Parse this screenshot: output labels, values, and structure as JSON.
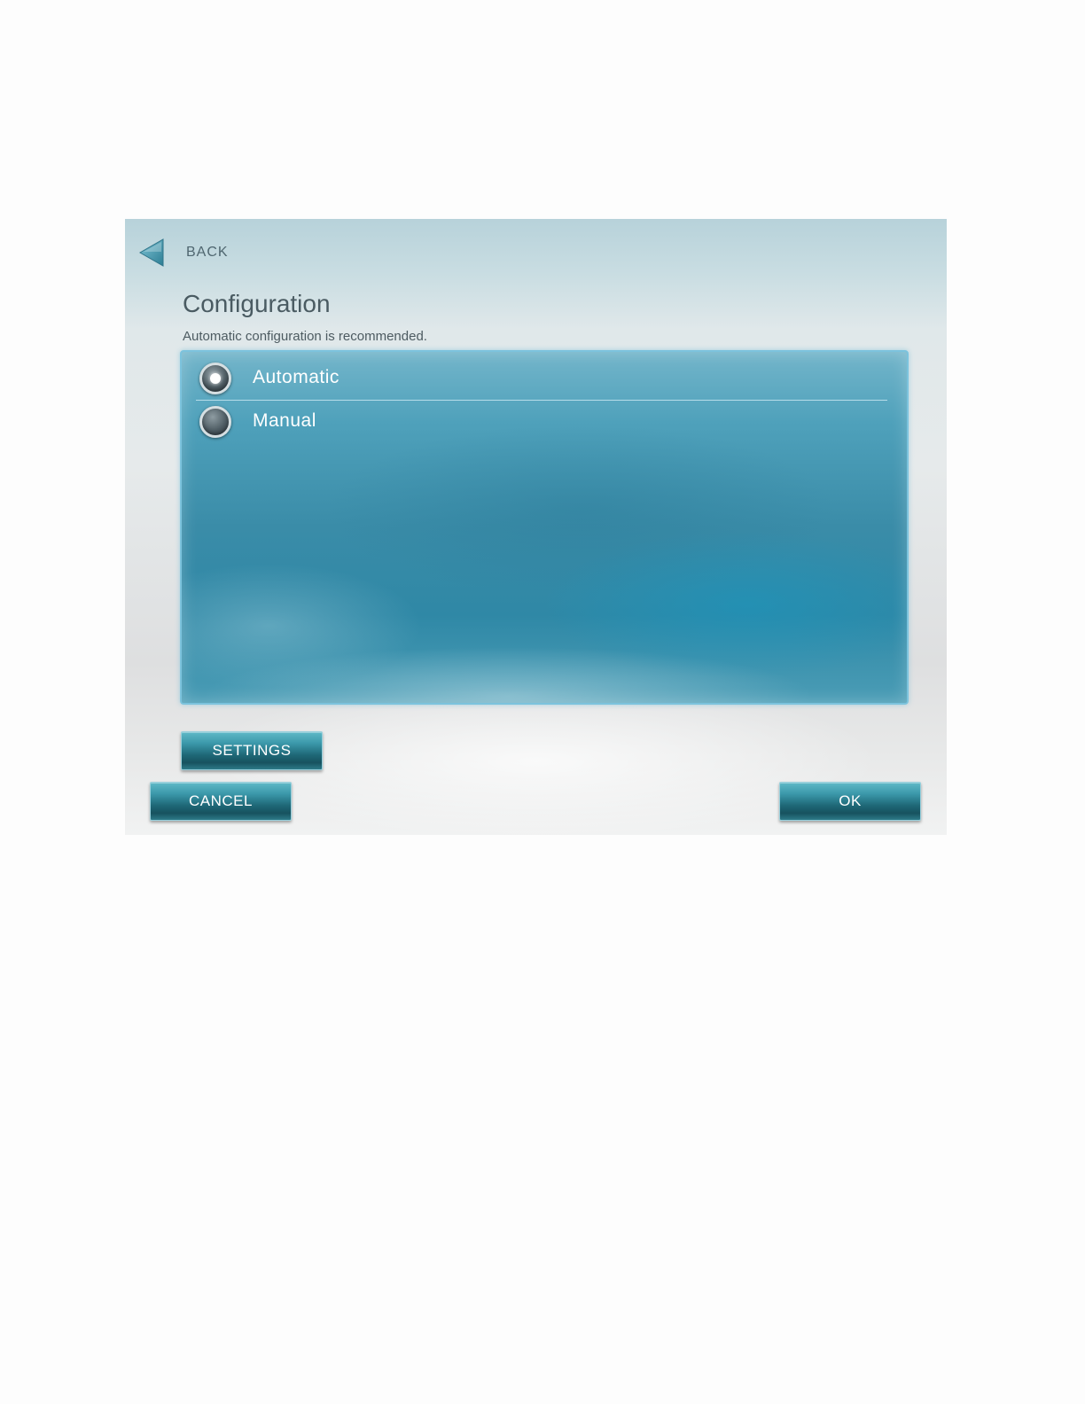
{
  "nav": {
    "back_label": "BACK"
  },
  "header": {
    "title": "Configuration",
    "subtitle": "Automatic configuration is recommended."
  },
  "options": {
    "automatic_label": "Automatic",
    "manual_label": "Manual",
    "selected": "Automatic"
  },
  "buttons": {
    "settings_label": "SETTINGS",
    "cancel_label": "CANCEL",
    "ok_label": "OK"
  },
  "colors": {
    "panel_blue": "#3a8ca8",
    "button_teal": "#1e6776",
    "panel_border": "#7cc3dd"
  },
  "icons": {
    "back": "back-arrow-icon",
    "radio_selected": "radio-selected-icon",
    "radio_unselected": "radio-unselected-icon"
  }
}
